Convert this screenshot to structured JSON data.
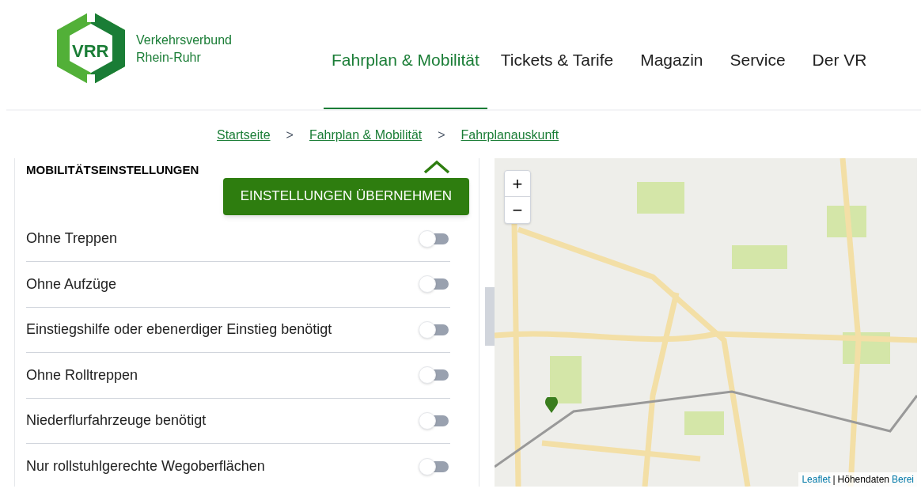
{
  "logo": {
    "mark": "VRR",
    "name_line_1": "Verkehrsverbund",
    "name_line_2": "Rhein-Ruhr"
  },
  "nav": [
    {
      "label": "Fahrplan & Mobilität",
      "selected": true
    },
    {
      "label": "Tickets & Tarife",
      "selected": false
    },
    {
      "label": "Magazin",
      "selected": false
    },
    {
      "label": "Service",
      "selected": false
    },
    {
      "label": "Der VR",
      "selected": false
    }
  ],
  "breadcrumb": [
    "Startseite",
    "Fahrplan & Mobilität",
    "Fahrplanauskunft"
  ],
  "breadcrumb_separator": ">",
  "settings": {
    "title": "MOBILITÄTSEINSTELLUNGEN",
    "expanded": true,
    "apply_button": "EINSTELLUNGEN ÜBERNEHMEN",
    "options": [
      {
        "label": "Ohne Treppen",
        "on": false
      },
      {
        "label": "Ohne Aufzüge",
        "on": false
      },
      {
        "label": "Einstiegshilfe oder ebenerdiger Einstieg benötigt",
        "on": false
      },
      {
        "label": "Ohne Rolltreppen",
        "on": false
      },
      {
        "label": "Niederflurfahrzeuge benötigt",
        "on": false
      },
      {
        "label": "Nur rollstuhlgerechte Wegoberflächen",
        "on": false
      }
    ]
  },
  "map": {
    "zoom_in": "+",
    "zoom_out": "−",
    "attribution_link": "Leaflet",
    "attribution_separator": "|",
    "attribution_text": "Höhendaten",
    "attribution_link_2": "Berei"
  }
}
